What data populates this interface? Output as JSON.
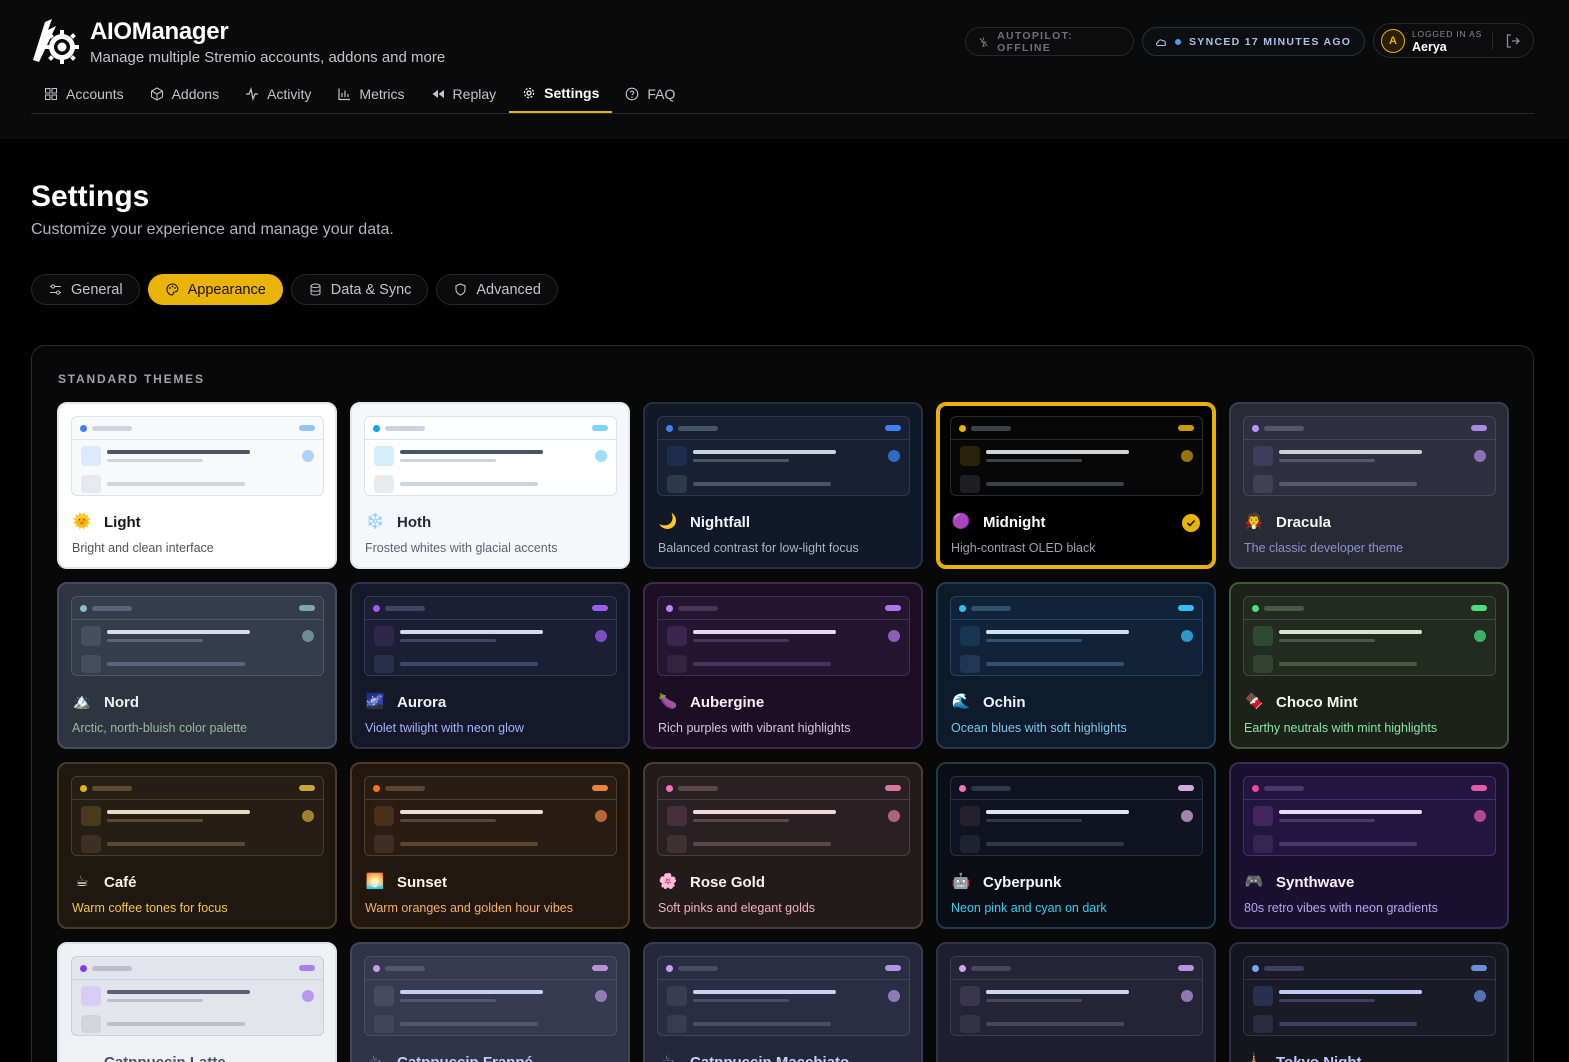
{
  "header": {
    "title": "AIOManager",
    "subtitle": "Manage multiple Stremio accounts, addons and more",
    "autopilot": "AUTOPILOT: OFFLINE",
    "sync": "SYNCED 17 MINUTES AGO",
    "logged_label": "LOGGED IN AS",
    "user_name": "Aerya",
    "avatar_initial": "A"
  },
  "nav": {
    "items": [
      {
        "label": "Accounts",
        "icon": "grid-icon"
      },
      {
        "label": "Addons",
        "icon": "box-icon"
      },
      {
        "label": "Activity",
        "icon": "activity-icon"
      },
      {
        "label": "Metrics",
        "icon": "bar-chart-icon"
      },
      {
        "label": "Replay",
        "icon": "rewind-icon"
      },
      {
        "label": "Settings",
        "icon": "gear-icon",
        "active": true
      },
      {
        "label": "FAQ",
        "icon": "help-circle-icon"
      }
    ]
  },
  "page": {
    "title": "Settings",
    "subtitle": "Customize your experience and manage your data."
  },
  "tabs": [
    {
      "label": "General",
      "icon": "sliders-icon"
    },
    {
      "label": "Appearance",
      "icon": "palette-icon",
      "active": true
    },
    {
      "label": "Data & Sync",
      "icon": "database-icon"
    },
    {
      "label": "Advanced",
      "icon": "shield-icon"
    }
  ],
  "themes_section": {
    "heading": "STANDARD THEMES",
    "themes": [
      {
        "name": "Light",
        "desc": "Bright and clean interface",
        "emoji": "🌞",
        "bg": "#ffffff",
        "border": "#e4e4e7",
        "name_color": "#18181b",
        "desc_color": "#52525b",
        "prev_bg": "#f8f9fb",
        "prev_border": "#dfe2e8",
        "line": "#4b5563",
        "muted": "#d1d5db",
        "accent": "#3b82f6",
        "accent_soft": "#dbeafe",
        "pill": "#93c5fd"
      },
      {
        "name": "Hoth",
        "desc": "Frosted whites with glacial accents",
        "emoji": "❄️",
        "bg": "#f5f7fa",
        "border": "#e2e8f0",
        "name_color": "#1e293b",
        "desc_color": "#5b6576",
        "prev_bg": "#ffffff",
        "prev_border": "#dde3ea",
        "line": "#475569",
        "muted": "#cbd5e1",
        "accent": "#0ea5e9",
        "accent_soft": "#d6eefa",
        "pill": "#7dd3fc"
      },
      {
        "name": "Nightfall",
        "desc": "Balanced contrast for low-light focus",
        "emoji": "🌙",
        "bg": "#111827",
        "border": "#243045",
        "name_color": "#f1f5f9",
        "desc_color": "#aab4c4",
        "prev_bg": "#182133",
        "prev_border": "#2c3850",
        "line": "#cbd5e1",
        "muted": "#475569",
        "accent": "#3b82f6",
        "accent_soft": "#1e2d4a",
        "pill": "#3b82f6"
      },
      {
        "name": "Midnight",
        "desc": "High-contrast OLED black",
        "emoji": "🟣",
        "bg": "#000000",
        "border": "#eab308",
        "name_color": "#ffffff",
        "desc_color": "#a1a1aa",
        "prev_bg": "#070707",
        "prev_border": "#2a2a2e",
        "line": "#d4d4d8",
        "muted": "#3f3f46",
        "accent": "#eab308",
        "accent_soft": "#2a2208",
        "pill": "#ca9a06",
        "selected": true
      },
      {
        "name": "Dracula",
        "desc": "The classic developer theme",
        "emoji": "🧛",
        "bg": "#282a36",
        "border": "#3a3d4e",
        "name_color": "#f8f8f2",
        "desc_color": "#8b93c9",
        "prev_bg": "#2e3040",
        "prev_border": "#44475a",
        "line": "#d0d0d8",
        "muted": "#55586a",
        "accent": "#bd93f9",
        "accent_soft": "#413b5e",
        "pill": "#a98ae0"
      },
      {
        "name": "Nord",
        "desc": "Arctic, north-bluish color palette",
        "emoji": "🏔️",
        "bg": "#2e3440",
        "border": "#434c5e",
        "name_color": "#eceff4",
        "desc_color": "#9bb89a",
        "prev_bg": "#353c4a",
        "prev_border": "#4c566a",
        "line": "#d8dee9",
        "muted": "#5a6478",
        "accent": "#88c0d0",
        "accent_soft": "#44505f",
        "pill": "#7fa6b3"
      },
      {
        "name": "Aurora",
        "desc": "Violet twilight with neon glow",
        "emoji": "🌌",
        "bg": "#141829",
        "border": "#2c3150",
        "name_color": "#f0f0ff",
        "desc_color": "#a5b4fc",
        "prev_bg": "#1a1f34",
        "prev_border": "#323858",
        "line": "#d6d8ee",
        "muted": "#3f4565",
        "accent": "#a855f7",
        "accent_soft": "#2e2648",
        "pill": "#9d5cf0"
      },
      {
        "name": "Aubergine",
        "desc": "Rich purples with vibrant highlights",
        "emoji": "🍆",
        "bg": "#1c0f24",
        "border": "#3f2552",
        "name_color": "#fbf0ff",
        "desc_color": "#d8c4e4",
        "prev_bg": "#241530",
        "prev_border": "#462c5a",
        "line": "#e6d8ee",
        "muted": "#4a3358",
        "accent": "#c084fc",
        "accent_soft": "#3c2450",
        "pill": "#b173e8"
      },
      {
        "name": "Ochin",
        "desc": "Ocean blues with soft highlights",
        "emoji": "🌊",
        "bg": "#0d1b2a",
        "border": "#213a55",
        "name_color": "#eaf4ff",
        "desc_color": "#7fc6ef",
        "prev_bg": "#112338",
        "prev_border": "#27425f",
        "line": "#cfe2f2",
        "muted": "#31506e",
        "accent": "#38bdf8",
        "accent_soft": "#173553",
        "pill": "#38bdf8"
      },
      {
        "name": "Choco Mint",
        "desc": "Earthy neutrals with mint highlights",
        "emoji": "🍫",
        "bg": "#1d2219",
        "border": "#3b5a3a",
        "name_color": "#f1f7ee",
        "desc_color": "#86e3a1",
        "prev_bg": "#232a1f",
        "prev_border": "#3a4a36",
        "line": "#d8e4d4",
        "muted": "#4a5a46",
        "accent": "#4ade80",
        "accent_soft": "#2f4a30",
        "pill": "#4ade80"
      },
      {
        "name": "Café",
        "desc": "Warm coffee tones for focus",
        "emoji": "☕",
        "bg": "#1f1810",
        "border": "#4a3a24",
        "name_color": "#fbf3e6",
        "desc_color": "#f5c542",
        "prev_bg": "#261d14",
        "prev_border": "#4d3d28",
        "line": "#e8dcc4",
        "muted": "#5a4a35",
        "accent": "#eab308",
        "accent_soft": "#4a3a1c",
        "pill": "#c9a43a"
      },
      {
        "name": "Sunset",
        "desc": "Warm oranges and golden hour vibes",
        "emoji": "🌅",
        "bg": "#21170f",
        "border": "#4f3a25",
        "name_color": "#fff4ea",
        "desc_color": "#f7b066",
        "prev_bg": "#281c13",
        "prev_border": "#523e2a",
        "line": "#f0dfcf",
        "muted": "#5b4533",
        "accent": "#f97316",
        "accent_soft": "#4a2f1b",
        "pill": "#e8823c"
      },
      {
        "name": "Rose Gold",
        "desc": "Soft pinks and elegant golds",
        "emoji": "🌸",
        "bg": "#231a1c",
        "border": "#4c3a3e",
        "name_color": "#fff0f2",
        "desc_color": "#f3b0c4",
        "prev_bg": "#2a2023",
        "prev_border": "#4e3c40",
        "line": "#f0d8de",
        "muted": "#5a464b",
        "accent": "#f472b6",
        "accent_soft": "#48303a",
        "pill": "#d7789c"
      },
      {
        "name": "Cyberpunk",
        "desc": "Neon pink and cyan on dark",
        "emoji": "🤖",
        "bg": "#0a0d14",
        "border": "#1f3a48",
        "name_color": "#f5f8ff",
        "desc_color": "#35d0f0",
        "prev_bg": "#0f1320",
        "prev_border": "#26303f",
        "line": "#dfe6f2",
        "muted": "#2e3848",
        "accent": "#f472b6",
        "accent_soft": "#25202e",
        "pill": "#d8a8e0"
      },
      {
        "name": "Synthwave",
        "desc": "80s retro vibes with neon gradients",
        "emoji": "🎮",
        "bg": "#1a1030",
        "border": "#3b2a5a",
        "name_color": "#fbf2ff",
        "desc_color": "#b3a8f5",
        "prev_bg": "#221540",
        "prev_border": "#43306a",
        "line": "#e5dcf5",
        "muted": "#4a3868",
        "accent": "#ec4899",
        "accent_soft": "#44255e",
        "pill": "#e45aa8"
      },
      {
        "name": "Catppuccin Latte",
        "desc": "",
        "emoji": "☕",
        "bg": "#eff1f5",
        "border": "#dce0e8",
        "name_color": "#4c4f69",
        "desc_color": "#6c6f85",
        "prev_bg": "#e3e5ec",
        "prev_border": "#ccd0da",
        "line": "#5c5f77",
        "muted": "#bcc0cc",
        "accent": "#8839ef",
        "accent_soft": "#d8cdf5",
        "pill": "#a87ff0"
      },
      {
        "name": "Catppuccin Frappé",
        "desc": "",
        "emoji": "☕",
        "bg": "#303446",
        "border": "#414559",
        "name_color": "#c6d0f5",
        "desc_color": "#a5adce",
        "prev_bg": "#353a50",
        "prev_border": "#4a4f66",
        "line": "#c6d0f5",
        "muted": "#51576d",
        "accent": "#ca9ee6",
        "accent_soft": "#484a62",
        "pill": "#b792d6"
      },
      {
        "name": "Catppuccin Macchiato",
        "desc": "",
        "emoji": "☕",
        "bg": "#24273a",
        "border": "#363a4f",
        "name_color": "#cad3f5",
        "desc_color": "#a5adcb",
        "prev_bg": "#2a2e44",
        "prev_border": "#40445a",
        "line": "#cad3f5",
        "muted": "#494d64",
        "accent": "#c6a0f6",
        "accent_soft": "#3a3c56",
        "pill": "#b392e0"
      },
      {
        "name": "",
        "desc": "",
        "emoji": "",
        "bg": "#1e1e2e",
        "border": "#313244",
        "name_color": "#cdd6f4",
        "desc_color": "#a6adc8",
        "prev_bg": "#242436",
        "prev_border": "#3a3b50",
        "line": "#cdd6f4",
        "muted": "#45475a",
        "accent": "#cba6f7",
        "accent_soft": "#3a3650",
        "pill": "#b494e0"
      },
      {
        "name": "Tokyo Night",
        "desc": "",
        "emoji": "🗼",
        "bg": "#16161e",
        "border": "#292e42",
        "name_color": "#c0caf5",
        "desc_color": "#9aa5ce",
        "prev_bg": "#1a1b26",
        "prev_border": "#2f344a",
        "line": "#c0caf5",
        "muted": "#3b4261",
        "accent": "#7aa2f7",
        "accent_soft": "#283050",
        "pill": "#6a8ee0"
      }
    ]
  }
}
